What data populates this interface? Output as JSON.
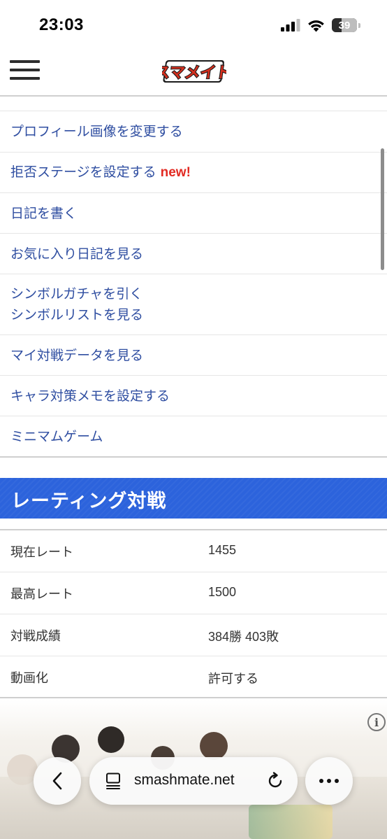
{
  "status_bar": {
    "time": "23:03",
    "battery_level": "39",
    "battery_fraction": 0.39,
    "signal_icon": "cellular-signal-icon",
    "wifi_icon": "wifi-icon"
  },
  "header": {
    "menu_icon": "hamburger-menu-icon",
    "logo_text": "スマメイト"
  },
  "menu": {
    "items": [
      {
        "label": "プロフィール画像を変更する"
      },
      {
        "label": "拒否ステージを設定する",
        "badge": "new!"
      },
      {
        "label": "日記を書く"
      },
      {
        "label": "お気に入り日記を見る"
      },
      {
        "label": "シンボルガチャを引く",
        "label2": "シンボルリストを見る"
      },
      {
        "label": "マイ対戦データを見る"
      },
      {
        "label": "キャラ対策メモを設定する"
      },
      {
        "label": "ミニマムゲーム"
      }
    ]
  },
  "section": {
    "title": "レーティング対戦"
  },
  "stats": {
    "rows": [
      {
        "label": "現在レート",
        "value": "1455"
      },
      {
        "label": "最高レート",
        "value": "1500"
      },
      {
        "label": "対戦成績",
        "value": "384勝 403敗"
      },
      {
        "label": "動画化",
        "value": "許可する"
      }
    ]
  },
  "ad": {
    "info_icon": "info-icon"
  },
  "browser": {
    "url": "smashmate.net",
    "back_icon": "chevron-left-icon",
    "tabs_icon": "tabs-icon",
    "reload_icon": "reload-icon",
    "more_icon": "more-dots-icon"
  },
  "colors": {
    "link": "#2f4ea1",
    "new_badge": "#e22a22",
    "section_banner": "#2c63dc"
  }
}
